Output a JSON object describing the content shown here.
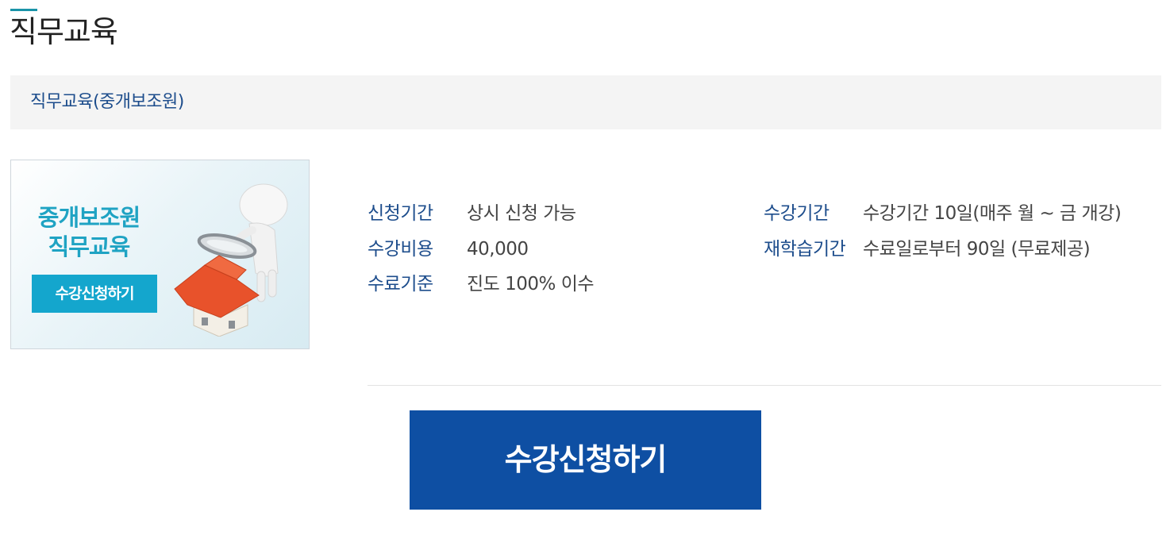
{
  "header": {
    "title": "직무교육"
  },
  "breadcrumb": {
    "label": "직무교육(중개보조원)"
  },
  "banner": {
    "title_line1": "중개보조원",
    "title_line2": "직무교육",
    "button_label": "수강신청하기"
  },
  "info_left": [
    {
      "label": "신청기간",
      "value": "상시 신청 가능"
    },
    {
      "label": "수강비용",
      "value": "40,000"
    },
    {
      "label": "수료기준",
      "value": "진도 100% 이수"
    }
  ],
  "info_right": [
    {
      "label": "수강기간",
      "value": "수강기간 10일(매주 월 ~ 금 개강)"
    },
    {
      "label": "재학습기간",
      "value": "수료일로부터 90일 (무료제공)"
    }
  ],
  "apply_button": {
    "label": "수강신청하기"
  },
  "colors": {
    "accent": "#1a94a8",
    "label_blue": "#1d4d8c",
    "button_blue": "#0e4fa3",
    "banner_cyan": "#14a6cd",
    "house_red": "#e8522b"
  }
}
